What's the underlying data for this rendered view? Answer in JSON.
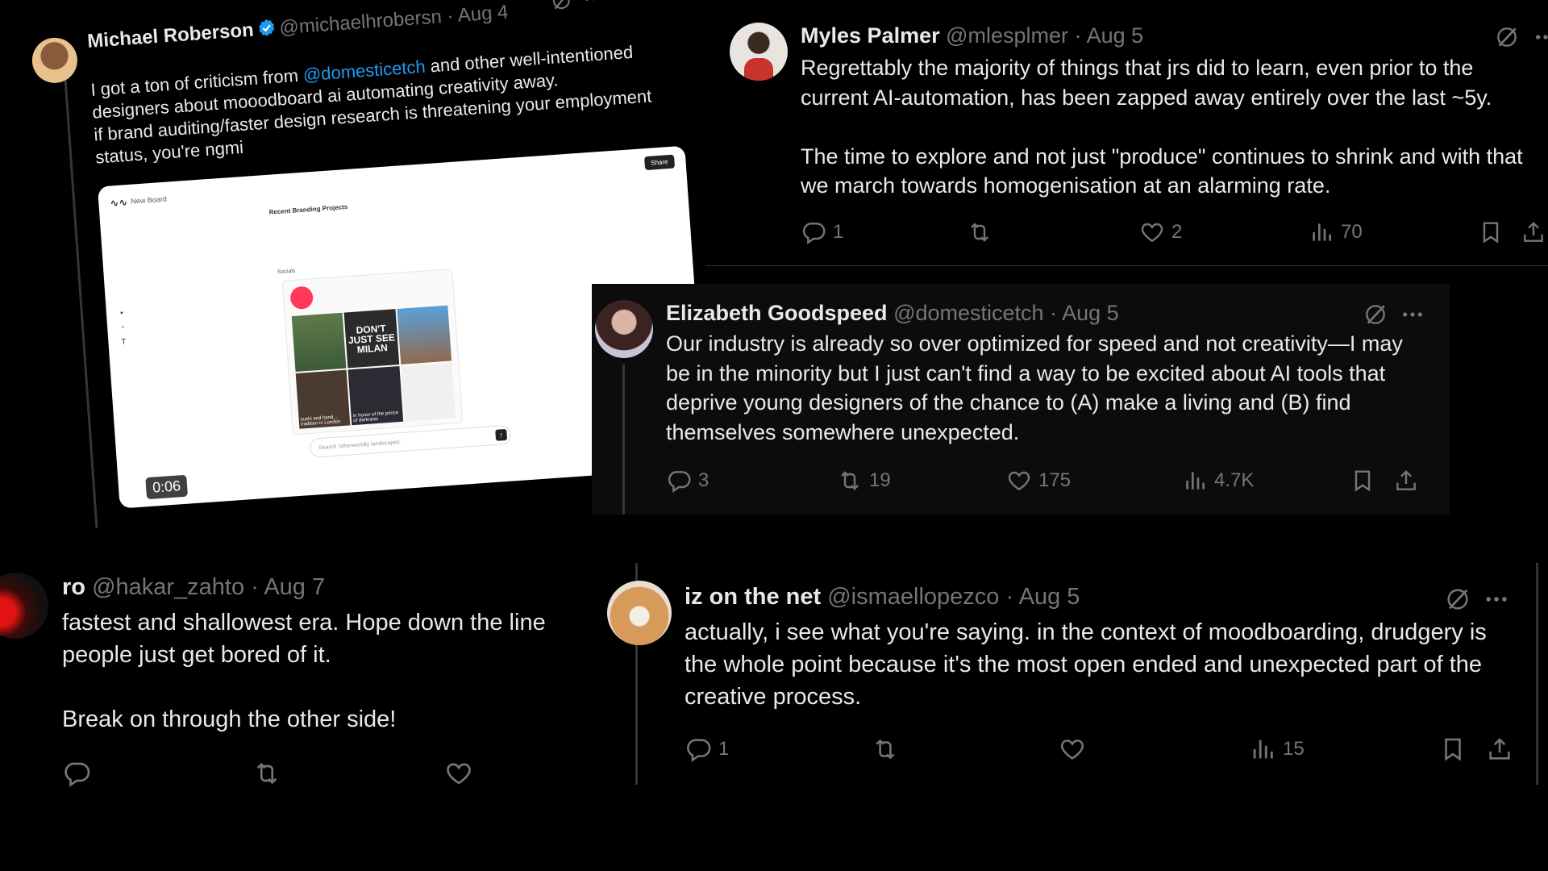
{
  "colors": {
    "background": "#000000",
    "text": "#e7e9ea",
    "muted": "#71767b",
    "link": "#1d9bf0",
    "verified": "#1d9bf0"
  },
  "tweet_michael": {
    "name": "Michael Roberson",
    "handle": "@michaelhrobersn",
    "date": "Aug 4",
    "text_before": "I got a ton of criticism from ",
    "mention": "@domesticetch",
    "text_after": " and other well-intentioned designers about mooodboard ai automating creativity away.",
    "text_2": "if brand auditing/faster design research is threatening your employment status, you're ngmi",
    "video": {
      "board_title": "New Board",
      "share_label": "Share",
      "section_title": "Recent Branding Projects",
      "socials_label": "Socials",
      "poster_text": "DON'T JUST SEE MILAN",
      "caption_1": "sushi and hand... tradition in London",
      "caption_2": "in honor of the prince of darkness",
      "search_placeholder": "Search 'otherworldly landscapes'",
      "duration": "0:06"
    }
  },
  "tweet_myles": {
    "name": "Myles Palmer",
    "handle": "@mlesplmer",
    "date": "Aug 5",
    "text": "Regrettably the majority of things that jrs did to learn, even prior to the current AI-automation, has been zapped away entirely over the last ~5y.\n\nThe time to explore and not just \"produce\" continues to shrink and with that we march towards homogenisation at an alarming rate.",
    "replies": "1",
    "retweets": "",
    "likes": "2",
    "views": "70"
  },
  "tweet_elizabeth": {
    "name": "Elizabeth Goodspeed",
    "handle": "@domesticetch",
    "date": "Aug 5",
    "text": "Our industry is already so over optimized for speed and not creativity—I may be in the minority but I just can't find a way to be excited about AI tools that deprive young designers of the chance to (A) make a living and (B) find themselves somewhere unexpected.",
    "replies": "3",
    "retweets": "19",
    "likes": "175",
    "views": "4.7K"
  },
  "tweet_ro": {
    "name": "ro",
    "handle": "@hakar_zahto",
    "date": "Aug 7",
    "text": "fastest and shallowest era. Hope down the line people just get bored of it.\n\nBreak on through the other side!"
  },
  "tweet_iz": {
    "name": "iz on the net",
    "handle": "@ismaellopezco",
    "date": "Aug 5",
    "text": "actually, i see what you're saying. in the context of moodboarding, drudgery is the whole point because it's the most open ended and unexpected part of the creative process.",
    "replies": "1",
    "retweets": "",
    "likes": "",
    "views": "15"
  },
  "separator": "·",
  "icons": [
    "reply-icon",
    "retweet-icon",
    "like-icon",
    "views-icon",
    "bookmark-icon",
    "share-icon",
    "grok-icon",
    "more-icon",
    "verified-badge-icon"
  ]
}
